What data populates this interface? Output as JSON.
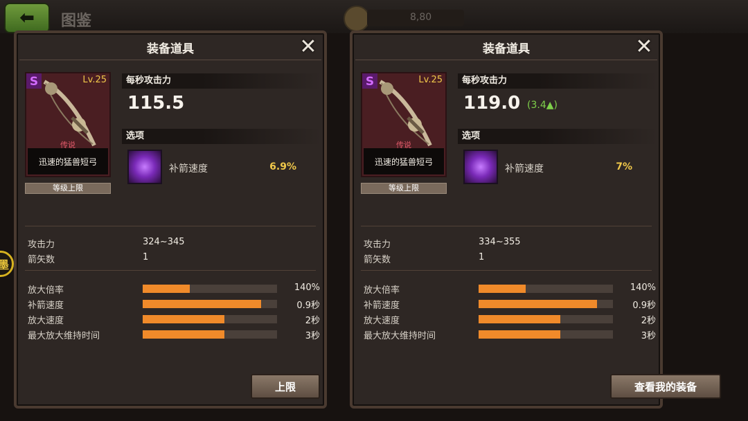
{
  "background": {
    "title": "图鉴",
    "coin_count": "8,80"
  },
  "side_badge": {
    "label": "墨"
  },
  "panels": [
    {
      "title": "装备道具",
      "item": {
        "level": "Lv.25",
        "rarity": "传说",
        "name": "迅速的猛兽短弓",
        "level_limit": "等级上限"
      },
      "dps_label": "每秒攻击力",
      "dps_value": "115.5",
      "dps_diff": "",
      "option_label": "选项",
      "option": {
        "name": "补箭速度",
        "value": "6.9%"
      },
      "stats": [
        {
          "label": "攻击力",
          "value": "324~345"
        },
        {
          "label": "箭矢数",
          "value": "1"
        }
      ],
      "bars": [
        {
          "label": "放大倍率",
          "value": "140%",
          "fill": 0.35
        },
        {
          "label": "补箭速度",
          "value": "0.9秒",
          "fill": 0.88
        },
        {
          "label": "放大速度",
          "value": "2秒",
          "fill": 0.61
        },
        {
          "label": "最大放大维持时间",
          "value": "3秒",
          "fill": 0.61
        }
      ],
      "button": "上限"
    },
    {
      "title": "装备道具",
      "item": {
        "level": "Lv.25",
        "rarity": "传说",
        "name": "迅速的猛兽短弓",
        "level_limit": "等级上限"
      },
      "dps_label": "每秒攻击力",
      "dps_value": "119.0",
      "dps_diff": "(3.4▲)",
      "option_label": "选项",
      "option": {
        "name": "补箭速度",
        "value": "7%"
      },
      "stats": [
        {
          "label": "攻击力",
          "value": "334~355"
        },
        {
          "label": "箭矢数",
          "value": "1"
        }
      ],
      "bars": [
        {
          "label": "放大倍率",
          "value": "140%",
          "fill": 0.35
        },
        {
          "label": "补箭速度",
          "value": "0.9秒",
          "fill": 0.88
        },
        {
          "label": "放大速度",
          "value": "2秒",
          "fill": 0.61
        },
        {
          "label": "最大放大维持时间",
          "value": "3秒",
          "fill": 0.61
        }
      ],
      "button": "查看我的装备"
    }
  ],
  "colors": {
    "accent": "#f08a2a",
    "option_value": "#f0c84a",
    "diff_up": "#7ed04a",
    "legendary": "#e05a6a"
  },
  "icons": {
    "close": "close-icon",
    "back": "back-arrow-icon",
    "option": "arrow-reload-icon",
    "rarity": "s-rank-icon"
  }
}
